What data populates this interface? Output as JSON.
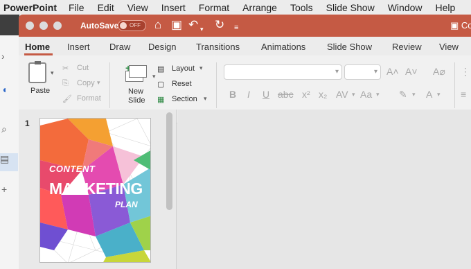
{
  "menubar": {
    "app_name": "PowerPoint",
    "items": [
      "File",
      "Edit",
      "View",
      "Insert",
      "Format",
      "Arrange",
      "Tools",
      "Slide Show",
      "Window",
      "Help"
    ]
  },
  "titlebar": {
    "autosave_label": "AutoSave",
    "autosave_state": "OFF",
    "doc_title_partial": "Co",
    "accent_color": "#c55a44"
  },
  "ribbon_tabs": [
    "Home",
    "Insert",
    "Draw",
    "Design",
    "Transitions",
    "Animations",
    "Slide Show",
    "Review",
    "View"
  ],
  "clipboard": {
    "paste": "Paste",
    "cut": "Cut",
    "copy": "Copy",
    "format": "Format"
  },
  "slides_group": {
    "new_slide_line1": "New",
    "new_slide_line2": "Slide",
    "layout": "Layout",
    "reset": "Reset",
    "section": "Section"
  },
  "slide_panel": {
    "slide_number": "1",
    "thumbnail_line1": "CONTENT",
    "thumbnail_line2": "MARKETING",
    "thumbnail_line3": "PLAN"
  }
}
